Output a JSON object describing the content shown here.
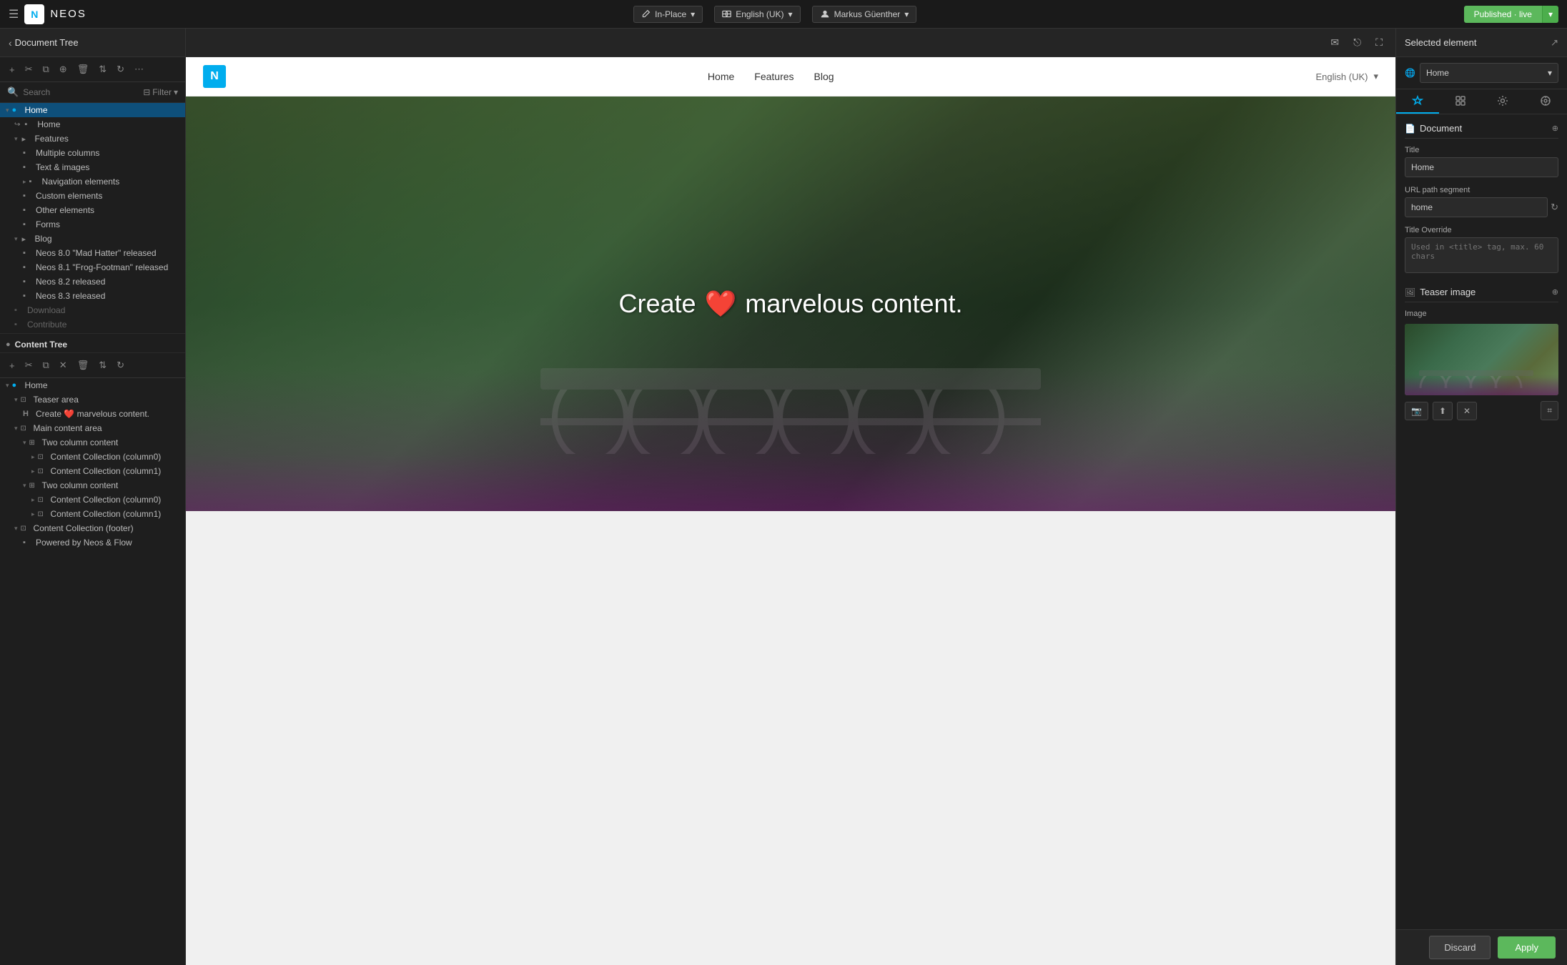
{
  "topbar": {
    "brand": "NEOS",
    "mode_label": "In-Place",
    "language_label": "English (UK)",
    "user_label": "Markus Güenther",
    "published_label": "Published · live"
  },
  "document_tree": {
    "title": "Document Tree",
    "search_placeholder": "Search",
    "filter_label": "Filter",
    "items": [
      {
        "label": "Home",
        "level": 0,
        "type": "home",
        "active": true
      },
      {
        "label": "Home",
        "level": 1,
        "type": "page"
      },
      {
        "label": "Features",
        "level": 1,
        "type": "folder"
      },
      {
        "label": "Multiple columns",
        "level": 2,
        "type": "page"
      },
      {
        "label": "Text & images",
        "level": 2,
        "type": "page"
      },
      {
        "label": "Navigation elements",
        "level": 2,
        "type": "page"
      },
      {
        "label": "Custom elements",
        "level": 2,
        "type": "page"
      },
      {
        "label": "Other elements",
        "level": 2,
        "type": "page"
      },
      {
        "label": "Forms",
        "level": 2,
        "type": "page"
      },
      {
        "label": "Blog",
        "level": 1,
        "type": "folder"
      },
      {
        "label": "Neos 8.0 \"Mad Hatter\" released",
        "level": 2,
        "type": "page"
      },
      {
        "label": "Neos 8.1 \"Frog-Footman\" released",
        "level": 2,
        "type": "page"
      },
      {
        "label": "Neos 8.2 released",
        "level": 2,
        "type": "page"
      },
      {
        "label": "Neos 8.3 released",
        "level": 2,
        "type": "page"
      },
      {
        "label": "Download",
        "level": 1,
        "type": "page-disabled"
      },
      {
        "label": "Contribute",
        "level": 1,
        "type": "page-disabled"
      }
    ]
  },
  "content_tree": {
    "title": "Content Tree",
    "items": [
      {
        "label": "Home",
        "level": 0,
        "type": "home"
      },
      {
        "label": "Teaser area",
        "level": 1,
        "type": "area"
      },
      {
        "label": "Create ❤️ marvelous content.",
        "level": 2,
        "type": "headline"
      },
      {
        "label": "Main content area",
        "level": 1,
        "type": "area"
      },
      {
        "label": "Two column content",
        "level": 2,
        "type": "columns"
      },
      {
        "label": "Content Collection (column0)",
        "level": 3,
        "type": "collection"
      },
      {
        "label": "Content Collection (column1)",
        "level": 3,
        "type": "collection"
      },
      {
        "label": "Two column content",
        "level": 2,
        "type": "columns"
      },
      {
        "label": "Content Collection (column0)",
        "level": 3,
        "type": "collection"
      },
      {
        "label": "Content Collection (column1)",
        "level": 3,
        "type": "collection"
      },
      {
        "label": "Content Collection (footer)",
        "level": 1,
        "type": "collection"
      },
      {
        "label": "Powered by Neos & Flow",
        "level": 2,
        "type": "page"
      }
    ]
  },
  "preview": {
    "nav": {
      "links": [
        "Home",
        "Features",
        "Blog"
      ],
      "language": "English (UK)"
    },
    "hero_text": "Create",
    "hero_emoji": "❤️",
    "hero_text2": "marvelous content."
  },
  "right_panel": {
    "title": "Selected element",
    "tabs": [
      "brush",
      "components",
      "gear",
      "target"
    ],
    "document_section": {
      "title": "Document",
      "title_label": "Title",
      "title_value": "Home",
      "url_label": "URL path segment",
      "url_value": "home",
      "title_override_label": "Title Override",
      "title_override_placeholder": "Used in <title> tag, max. 60 chars"
    },
    "teaser_section": {
      "title": "Teaser image",
      "image_label": "Image"
    },
    "home_dropdown": "Home",
    "discard_label": "Discard",
    "apply_label": "Apply"
  }
}
